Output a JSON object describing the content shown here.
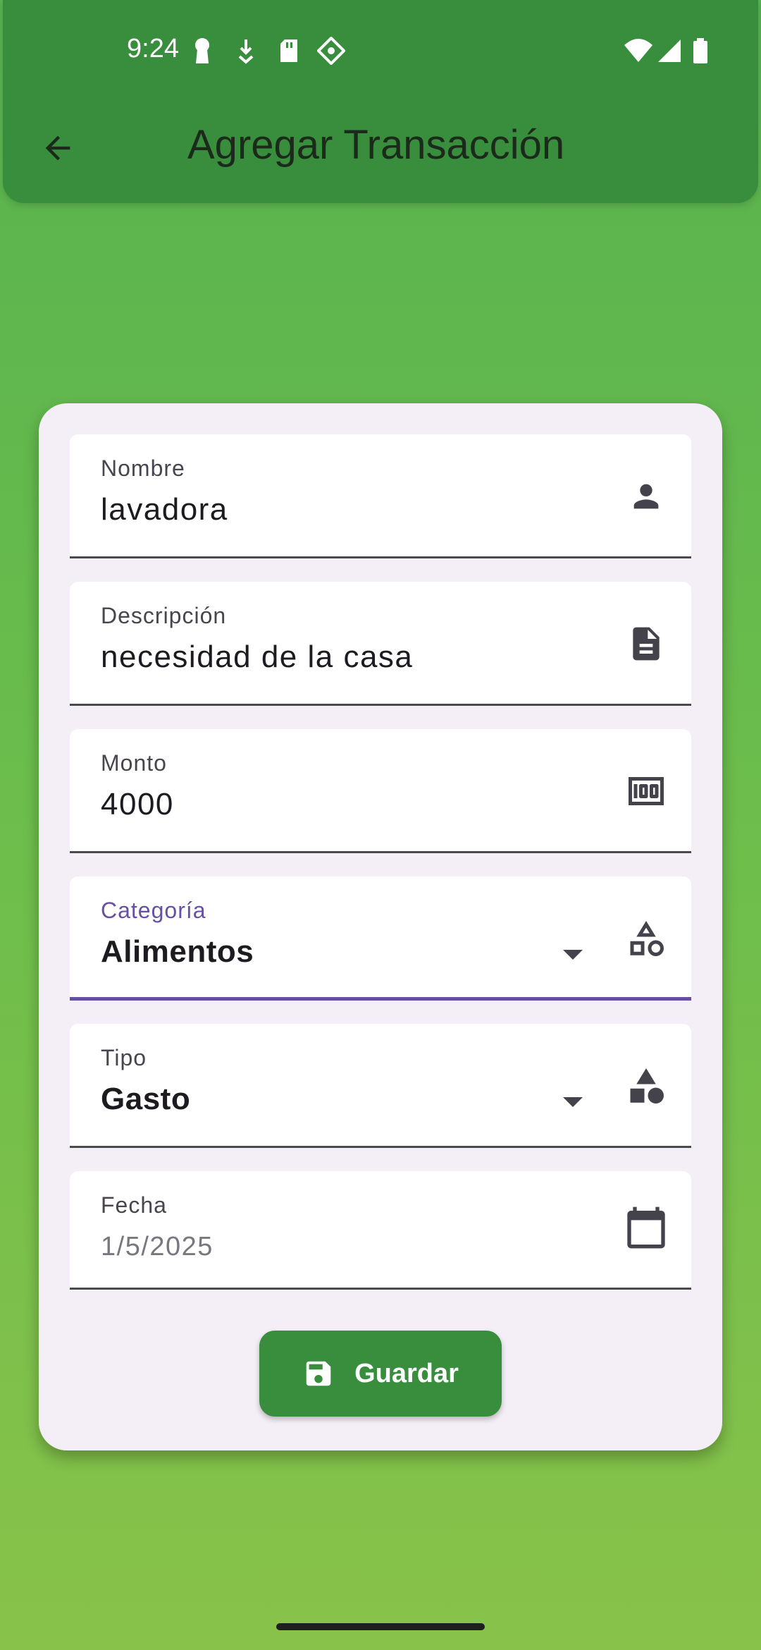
{
  "status_bar": {
    "time": "9:24"
  },
  "app_bar": {
    "title": "Agregar Transacción",
    "back_icon": "arrow-back-icon"
  },
  "form": {
    "nombre": {
      "label": "Nombre",
      "value": "lavadora",
      "icon": "person-icon"
    },
    "descripcion": {
      "label": "Descripción",
      "value": "necesidad de la casa",
      "icon": "document-icon"
    },
    "monto": {
      "label": "Monto",
      "value": "4000",
      "icon": "money-icon"
    },
    "categoria": {
      "label": "Categoría",
      "value": "Alimentos",
      "icon": "category-icon"
    },
    "tipo": {
      "label": "Tipo",
      "value": "Gasto",
      "icon": "shapes-icon"
    },
    "fecha": {
      "label": "Fecha",
      "placeholder": "1/5/2025",
      "icon": "calendar-icon"
    }
  },
  "actions": {
    "save_label": "Guardar",
    "save_icon": "save-icon"
  },
  "colors": {
    "app_bar": "#388e3c",
    "accent": "#6750a4",
    "card": "#f4eff7",
    "button": "#388e3c"
  }
}
